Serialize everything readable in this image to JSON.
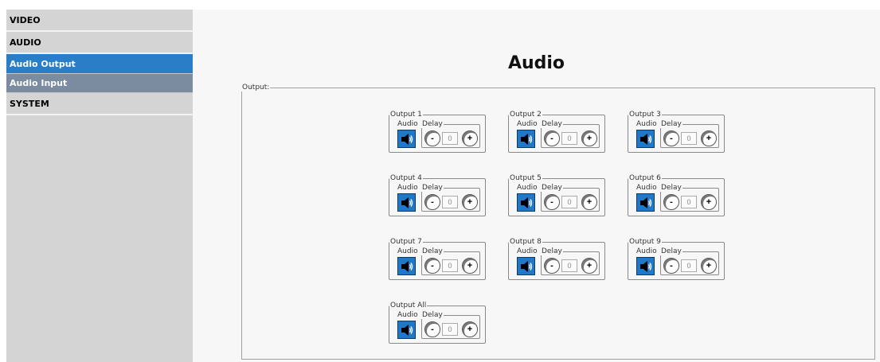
{
  "sidebar": {
    "items": [
      {
        "label": "VIDEO"
      },
      {
        "label": "AUDIO"
      },
      {
        "label": "Audio Output"
      },
      {
        "label": "Audio Input"
      },
      {
        "label": "SYSTEM"
      }
    ]
  },
  "main": {
    "title": "Audio",
    "output_group_label": "Output:",
    "audio_label": "Audio",
    "delay_label": "Delay",
    "minus_label": "-",
    "plus_label": "+",
    "channels": [
      {
        "label": "Output 1",
        "delay": "0"
      },
      {
        "label": "Output 2",
        "delay": "0"
      },
      {
        "label": "Output 3",
        "delay": "0"
      },
      {
        "label": "Output 4",
        "delay": "0"
      },
      {
        "label": "Output 5",
        "delay": "0"
      },
      {
        "label": "Output 6",
        "delay": "0"
      },
      {
        "label": "Output 7",
        "delay": "0"
      },
      {
        "label": "Output 8",
        "delay": "0"
      },
      {
        "label": "Output 9",
        "delay": "0"
      },
      {
        "label": "Output All",
        "delay": "0"
      }
    ]
  },
  "colors": {
    "accent": "#2a7ec7",
    "sub_nav": "#7b8ba0",
    "speaker_button": "#1f78c8"
  },
  "icons": {
    "audio_button": "speaker-icon"
  }
}
